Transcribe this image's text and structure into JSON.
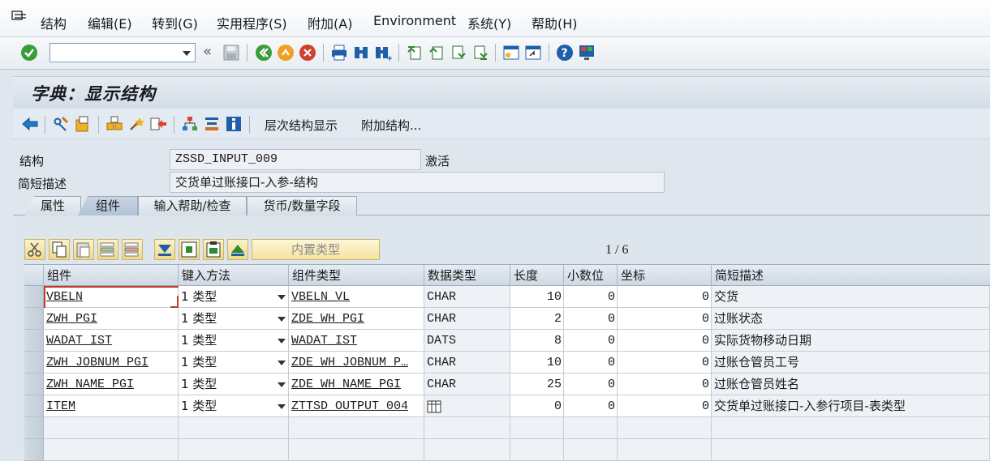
{
  "menu": {
    "items": [
      "结构",
      "编辑(E)",
      "转到(G)",
      "实用程序(S)",
      "附加(A)",
      "Environment",
      "系统(Y)",
      "帮助(H)"
    ]
  },
  "system_toolbar": {
    "command_field_value": ""
  },
  "screen": {
    "title": "字典：显示结构"
  },
  "app_toolbar": {
    "hierarchy_label": "层次结构显示",
    "append_label": "附加结构..."
  },
  "header": {
    "structure_label": "结构",
    "structure_value": "ZSSD_INPUT_009",
    "status": "激活",
    "short_desc_label": "简短描述",
    "short_desc_value": "交货单过账接口-入参-结构"
  },
  "tabs": [
    {
      "label": "属性",
      "active": false
    },
    {
      "label": "组件",
      "active": true
    },
    {
      "label": "输入帮助/检查",
      "active": false
    },
    {
      "label": "货币/数量字段",
      "active": false
    }
  ],
  "table_toolbar": {
    "builtin_type_label": "内置类型",
    "pager": "1 / 6"
  },
  "table": {
    "columns": [
      "组件",
      "键入方法",
      "组件类型",
      "数据类型",
      "长度",
      "小数位",
      "坐标",
      "简短描述"
    ],
    "rows": [
      {
        "component": "VBELN",
        "method": "1 类型",
        "comp_type": "VBELN_VL",
        "data_type": "CHAR",
        "length": "10",
        "decimals": "0",
        "coord": "0",
        "desc": "交货"
      },
      {
        "component": "ZWH_PGI",
        "method": "1 类型",
        "comp_type": "ZDE_WH_PGI",
        "data_type": "CHAR",
        "length": "2",
        "decimals": "0",
        "coord": "0",
        "desc": "过账状态"
      },
      {
        "component": "WADAT_IST",
        "method": "1 类型",
        "comp_type": "WADAT_IST",
        "data_type": "DATS",
        "length": "8",
        "decimals": "0",
        "coord": "0",
        "desc": "实际货物移动日期"
      },
      {
        "component": "ZWH_JOBNUM_PGI",
        "method": "1 类型",
        "comp_type": "ZDE_WH_JOBNUM_P…",
        "data_type": "CHAR",
        "length": "10",
        "decimals": "0",
        "coord": "0",
        "desc": "过账仓管员工号"
      },
      {
        "component": "ZWH_NAME_PGI",
        "method": "1 类型",
        "comp_type": "ZDE_WH_NAME_PGI",
        "data_type": "CHAR",
        "length": "25",
        "decimals": "0",
        "coord": "0",
        "desc": "过账仓管员姓名"
      },
      {
        "component": "ITEM",
        "method": "1 类型",
        "comp_type": "ZTTSD_OUTPUT_004",
        "data_type": "",
        "length": "0",
        "decimals": "0",
        "coord": "0",
        "desc": "交货单过账接口-入参行项目-表类型"
      }
    ]
  },
  "icons": [
    "menu-icon",
    "enter-icon",
    "save-icon",
    "back-icon",
    "exit-icon",
    "cancel-icon",
    "print-icon",
    "find-icon",
    "find-next-icon",
    "first-page-icon",
    "prev-page-icon",
    "next-page-icon",
    "last-page-icon",
    "new-session-icon",
    "shortcut-icon",
    "help-icon",
    "layout-icon",
    "other-object-icon",
    "display-change-icon",
    "activate-icon",
    "check-icon",
    "where-used-icon",
    "object-list-icon",
    "navigation-icon",
    "hierarchy-icon",
    "info-icon",
    "cut-icon",
    "copy-icon",
    "paste-icon",
    "insert-row-icon",
    "delete-row-icon",
    "table-type-icon"
  ],
  "colors": {
    "accent_blue": "#1f5fa8",
    "enter_green": "#3a9b3a",
    "selection_red": "#c0392b"
  }
}
